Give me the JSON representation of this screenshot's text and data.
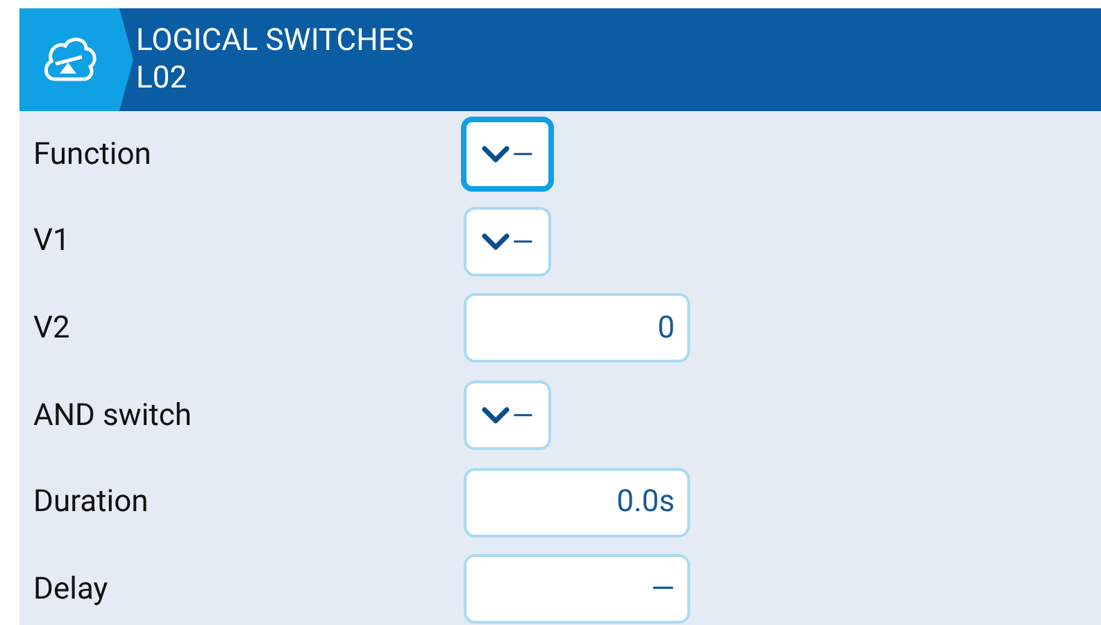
{
  "header": {
    "title": "LOGICAL SWITCHES",
    "subtitle": "L02"
  },
  "rows": [
    {
      "label": "Function",
      "kind": "choice",
      "value": "—",
      "focused": true
    },
    {
      "label": "V1",
      "kind": "choice",
      "value": "—",
      "focused": false
    },
    {
      "label": "V2",
      "kind": "number",
      "value": "0",
      "focused": false
    },
    {
      "label": "AND switch",
      "kind": "choice",
      "value": "—",
      "focused": false
    },
    {
      "label": "Duration",
      "kind": "number",
      "value": "0.0s",
      "focused": false
    },
    {
      "label": "Delay",
      "kind": "number",
      "value": "—",
      "focused": false
    }
  ]
}
